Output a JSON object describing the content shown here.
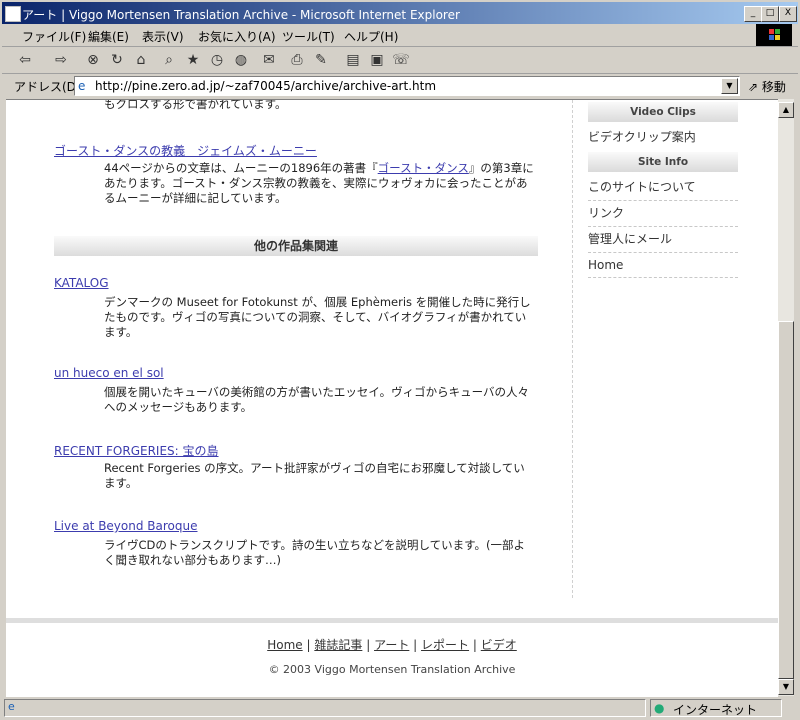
{
  "window": {
    "title": "アート | Viggo Mortensen Translation Archive - Microsoft Internet Explorer",
    "btn_min": "_",
    "btn_max": "□",
    "btn_close": "X"
  },
  "menu": [
    "ファイル(F)",
    "編集(E)",
    "表示(V)",
    "お気に入り(A)",
    "ツール(T)",
    "ヘルプ(H)"
  ],
  "address": {
    "label": "アドレス(D)",
    "url": "http://pine.zero.ad.jp/~zaf70045/archive/archive-art.htm",
    "go": "移動"
  },
  "content": {
    "partial_top": "もクロスする形で書かれています。",
    "ghost_dance": {
      "link": "ゴースト・ダンスの教義　ジェイムズ・ムーニー",
      "desc1": "44ページからの文章は、ムーニーの1896年の著書『",
      "desc_link": "ゴースト・ダンス",
      "desc2": "』の第3章にあたります。ゴースト・ダンス宗教の教義を、実際にウォヴォカに会ったことがあるムーニーが詳細に記しています。"
    },
    "section_title": "他の作品集関連",
    "items": [
      {
        "title": "KATALOG",
        "desc": "デンマークの Museet for Fotokunst が、個展 Ephèmeris を開催した時に発行したものです。ヴィゴの写真についての洞察、そして、バイオグラフィが書かれています。"
      },
      {
        "title": "un hueco en el sol",
        "desc": "個展を開いたキューバの美術館の方が書いたエッセイ。ヴィゴからキューバの人々へのメッセージもあります。"
      },
      {
        "title": "RECENT FORGERIES: 宝の島",
        "desc": "Recent Forgeries の序文。アート批評家がヴィゴの自宅にお邪魔して対談しています。"
      },
      {
        "title": "Live at Beyond Baroque",
        "desc": "ライヴCDのトランスクリプトです。詩の生い立ちなどを説明しています。(一部よく聞き取れない部分もあります…)"
      }
    ]
  },
  "sidebar": {
    "video_title": "Video Clips",
    "video_link": "ビデオクリップ案内",
    "site_title": "Site Info",
    "site_links": [
      "このサイトについて",
      "リンク",
      "管理人にメール",
      "Home"
    ]
  },
  "footer": {
    "nav": [
      "Home",
      "雑誌記事",
      "アート",
      "レポート",
      "ビデオ"
    ],
    "sep": "|",
    "copyright": "© 2003 Viggo Mortensen Translation Archive"
  },
  "status": {
    "zone": "インターネット"
  }
}
